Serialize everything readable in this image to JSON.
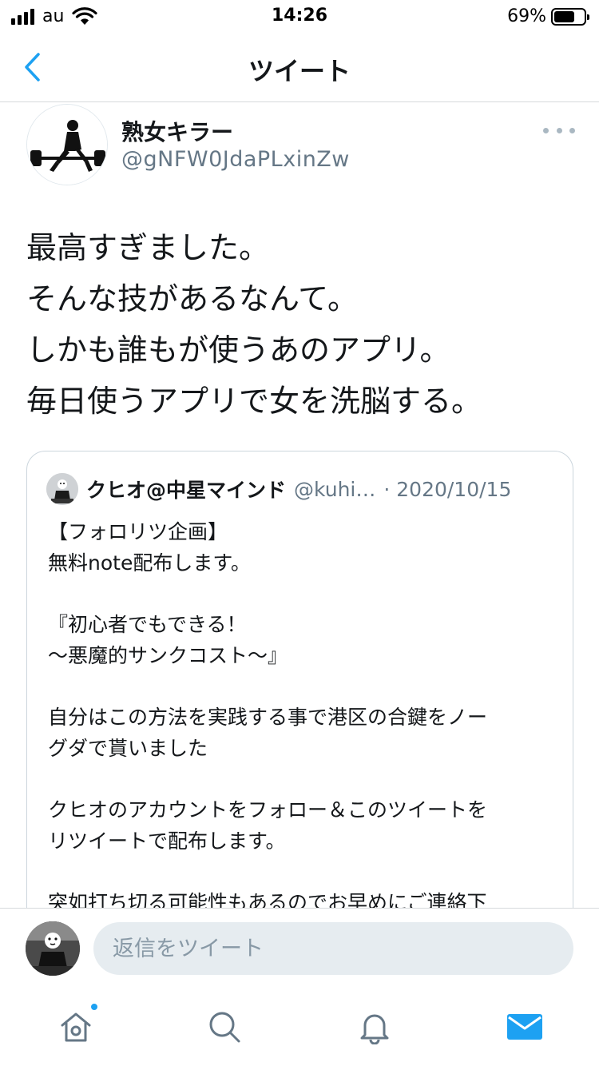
{
  "status_bar": {
    "carrier": "au",
    "time": "14:26",
    "battery_percent": "69%",
    "battery_level": 0.69
  },
  "nav": {
    "title": "ツイート",
    "back_icon": "chevron-left-icon"
  },
  "tweet": {
    "author_name": "熟女キラー",
    "author_handle": "@gNFW0JdaPLxinZw",
    "text_lines": [
      "最高すぎました。",
      "そんな技があるなんて。",
      "しかも誰もが使うあのアプリ。",
      "毎日使うアプリで女を洗脳する。"
    ],
    "more_icon": "more-horizontal-icon"
  },
  "quote": {
    "name": "クヒオ@中星マインド",
    "handle": "@kuhi…",
    "date": "· 2020/10/15",
    "lines": [
      "【フォロリツ企画】",
      "無料note配布します。",
      "",
      "『初心者でもできる！",
      "〜悪魔的サンクコスト〜』",
      "",
      "自分はこの方法を実践する事で港区の合鍵をノー",
      "グダで貰いました",
      "",
      "クヒオのアカウントをフォロー＆このツイートを",
      "リツイートで配布します。",
      "",
      "突如打ち切る可能性もあるのでお早めにご連絡下"
    ]
  },
  "reply": {
    "placeholder": "返信をツイート"
  },
  "tabs": [
    {
      "name": "home",
      "icon": "home-icon",
      "has_badge": true
    },
    {
      "name": "search",
      "icon": "search-icon",
      "has_badge": false
    },
    {
      "name": "notifications",
      "icon": "bell-icon",
      "has_badge": false
    },
    {
      "name": "messages",
      "icon": "envelope-icon",
      "has_badge": false,
      "active": true
    }
  ],
  "colors": {
    "accent": "#1da1f2",
    "text": "#14171a",
    "secondary": "#657786",
    "tab_icon": "#657786"
  }
}
